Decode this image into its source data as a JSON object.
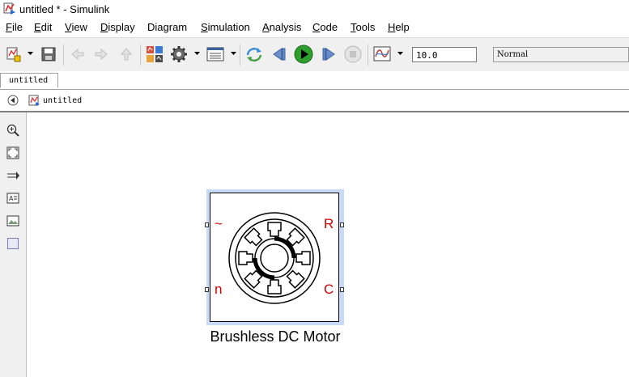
{
  "window": {
    "title": "untitled * - Simulink"
  },
  "menu": [
    {
      "key": "F",
      "rest": "ile"
    },
    {
      "key": "E",
      "rest": "dit"
    },
    {
      "key": "V",
      "rest": "iew"
    },
    {
      "key": "D",
      "rest": "isplay"
    },
    {
      "key": "",
      "rest": "Diagram"
    },
    {
      "key": "S",
      "rest": "imulation"
    },
    {
      "key": "A",
      "rest": "nalysis"
    },
    {
      "key": "C",
      "rest": "ode"
    },
    {
      "key": "T",
      "rest": "ools"
    },
    {
      "key": "H",
      "rest": "elp"
    }
  ],
  "toolbar": {
    "stop_time": "10.0",
    "sim_mode": "Normal",
    "icons": [
      "new-model-icon",
      "save-icon",
      "back-icon",
      "forward-icon",
      "up-icon",
      "library-browser-icon",
      "model-settings-icon",
      "model-explorer-icon",
      "step-back-icon",
      "run-icon",
      "step-forward-icon",
      "stop-icon",
      "data-inspector-icon"
    ]
  },
  "tabs": [
    {
      "label": "untitled",
      "active": true
    }
  ],
  "address": {
    "crumb": "untitled"
  },
  "palette": [
    "zoom-in-icon",
    "fit-to-view-icon",
    "arrow-icon",
    "annotation-icon",
    "image-icon",
    "area-icon"
  ],
  "block": {
    "name": "Brushless DC Motor",
    "ports": {
      "left_top": "~",
      "left_bottom": "n",
      "right_top": "R",
      "right_bottom": "C"
    },
    "label_color": "#d00000",
    "selected": true
  },
  "colors": {
    "selection": "#c8daf8",
    "toolbar_bg": "#f0f0f0",
    "run_green": "#2e9e2e"
  }
}
